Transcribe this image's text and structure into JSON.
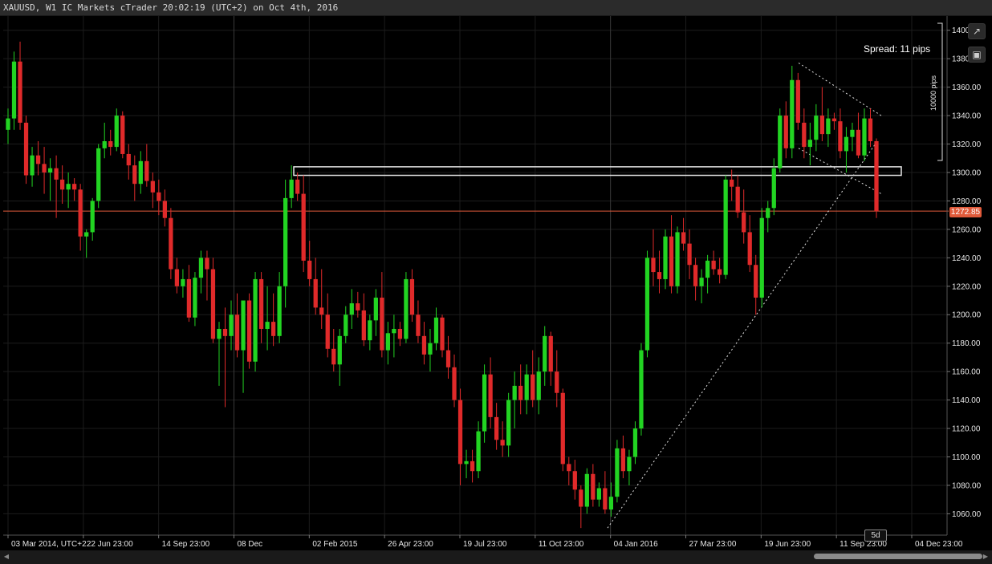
{
  "window": {
    "title": "XAUUSD, W1 IC Markets cTrader 20:02:19 (UTC+2) on Oct 4th, 2016"
  },
  "overlay": {
    "spread_text": "Spread: 11 pips",
    "pips_label": "10000 pips",
    "current_price": "1272.85",
    "timeframe_badge": "5d",
    "popout_icon": "popout-icon",
    "camera_icon": "camera-icon"
  },
  "colors": {
    "background": "#000000",
    "bull": "#22d422",
    "bear": "#e02a2a",
    "price_line": "#e05a3a",
    "grid": "#1c1c1c",
    "axis_text": "#e6e6e6"
  },
  "chart_data": {
    "type": "candlestick",
    "symbol": "XAUUSD",
    "timeframe": "W1",
    "ylim": [
      1045,
      1410
    ],
    "y_ticks": [
      1060,
      1080,
      1100,
      1120,
      1140,
      1160,
      1180,
      1200,
      1220,
      1240,
      1260,
      1280,
      1300,
      1320,
      1340,
      1360,
      1380,
      1400
    ],
    "y_tick_labels": [
      "1060.00",
      "1080.00",
      "1100.00",
      "1120.00",
      "1140.00",
      "1160.00",
      "1180.00",
      "1200.00",
      "1220.00",
      "1240.00",
      "1260.00",
      "1280.00",
      "1300.00",
      "1320.00",
      "1340.00",
      "1360.00",
      "1380.00",
      "1400.00"
    ],
    "x_tick_labels": [
      "03 Mar 2014, UTC+2",
      "22 Jun 23:00",
      "14 Sep 23:00",
      "08 Dec",
      "02 Feb 2015",
      "26 Apr 23:00",
      "19 Jul 23:00",
      "11 Oct 23:00",
      "04 Jan 2016",
      "27 Mar 23:00",
      "19 Jun 23:00",
      "11 Sep 23:00",
      "04 Dec 23:00"
    ],
    "current_price": 1272.85,
    "candles": [
      [
        1330,
        1345,
        1320,
        1338
      ],
      [
        1338,
        1385,
        1330,
        1378
      ],
      [
        1378,
        1392,
        1330,
        1335
      ],
      [
        1335,
        1340,
        1292,
        1298
      ],
      [
        1298,
        1318,
        1290,
        1312
      ],
      [
        1312,
        1322,
        1298,
        1306
      ],
      [
        1306,
        1318,
        1285,
        1300
      ],
      [
        1300,
        1310,
        1280,
        1303
      ],
      [
        1303,
        1312,
        1268,
        1295
      ],
      [
        1295,
        1305,
        1278,
        1288
      ],
      [
        1288,
        1300,
        1275,
        1292
      ],
      [
        1292,
        1296,
        1280,
        1288
      ],
      [
        1288,
        1292,
        1245,
        1255
      ],
      [
        1255,
        1260,
        1240,
        1258
      ],
      [
        1258,
        1282,
        1252,
        1280
      ],
      [
        1280,
        1320,
        1275,
        1317
      ],
      [
        1317,
        1335,
        1310,
        1322
      ],
      [
        1322,
        1330,
        1312,
        1318
      ],
      [
        1318,
        1345,
        1315,
        1340
      ],
      [
        1340,
        1343,
        1310,
        1313
      ],
      [
        1313,
        1320,
        1295,
        1305
      ],
      [
        1305,
        1312,
        1280,
        1292
      ],
      [
        1292,
        1315,
        1285,
        1308
      ],
      [
        1308,
        1320,
        1290,
        1294
      ],
      [
        1294,
        1300,
        1275,
        1286
      ],
      [
        1286,
        1295,
        1270,
        1280
      ],
      [
        1280,
        1288,
        1262,
        1268
      ],
      [
        1268,
        1275,
        1225,
        1232
      ],
      [
        1232,
        1240,
        1215,
        1220
      ],
      [
        1220,
        1232,
        1212,
        1225
      ],
      [
        1225,
        1235,
        1195,
        1198
      ],
      [
        1198,
        1230,
        1192,
        1226
      ],
      [
        1226,
        1245,
        1215,
        1240
      ],
      [
        1240,
        1245,
        1210,
        1232
      ],
      [
        1232,
        1240,
        1180,
        1183
      ],
      [
        1183,
        1195,
        1150,
        1190
      ],
      [
        1190,
        1205,
        1135,
        1185
      ],
      [
        1185,
        1210,
        1175,
        1200
      ],
      [
        1200,
        1215,
        1170,
        1175
      ],
      [
        1175,
        1198,
        1145,
        1210
      ],
      [
        1210,
        1215,
        1162,
        1167
      ],
      [
        1167,
        1230,
        1160,
        1225
      ],
      [
        1225,
        1230,
        1180,
        1190
      ],
      [
        1190,
        1220,
        1175,
        1195
      ],
      [
        1195,
        1215,
        1178,
        1185
      ],
      [
        1185,
        1230,
        1180,
        1220
      ],
      [
        1220,
        1295,
        1205,
        1282
      ],
      [
        1282,
        1305,
        1275,
        1295
      ],
      [
        1295,
        1300,
        1280,
        1285
      ],
      [
        1285,
        1298,
        1230,
        1238
      ],
      [
        1238,
        1252,
        1220,
        1225
      ],
      [
        1225,
        1240,
        1200,
        1205
      ],
      [
        1205,
        1232,
        1190,
        1200
      ],
      [
        1200,
        1215,
        1170,
        1176
      ],
      [
        1176,
        1190,
        1160,
        1165
      ],
      [
        1165,
        1190,
        1150,
        1185
      ],
      [
        1185,
        1206,
        1180,
        1200
      ],
      [
        1200,
        1218,
        1190,
        1208
      ],
      [
        1208,
        1216,
        1198,
        1203
      ],
      [
        1203,
        1215,
        1178,
        1182
      ],
      [
        1182,
        1200,
        1175,
        1196
      ],
      [
        1196,
        1218,
        1185,
        1212
      ],
      [
        1212,
        1230,
        1170,
        1175
      ],
      [
        1175,
        1195,
        1165,
        1187
      ],
      [
        1187,
        1200,
        1170,
        1190
      ],
      [
        1190,
        1195,
        1178,
        1183
      ],
      [
        1183,
        1230,
        1180,
        1225
      ],
      [
        1225,
        1232,
        1195,
        1200
      ],
      [
        1200,
        1210,
        1180,
        1185
      ],
      [
        1185,
        1195,
        1165,
        1172
      ],
      [
        1172,
        1190,
        1160,
        1180
      ],
      [
        1180,
        1205,
        1175,
        1198
      ],
      [
        1198,
        1200,
        1170,
        1175
      ],
      [
        1175,
        1185,
        1155,
        1163
      ],
      [
        1163,
        1172,
        1135,
        1140
      ],
      [
        1140,
        1148,
        1080,
        1095
      ],
      [
        1095,
        1105,
        1085,
        1097
      ],
      [
        1097,
        1105,
        1082,
        1090
      ],
      [
        1090,
        1125,
        1085,
        1118
      ],
      [
        1118,
        1165,
        1110,
        1158
      ],
      [
        1158,
        1170,
        1120,
        1128
      ],
      [
        1128,
        1138,
        1105,
        1112
      ],
      [
        1112,
        1125,
        1100,
        1108
      ],
      [
        1108,
        1145,
        1100,
        1140
      ],
      [
        1140,
        1160,
        1120,
        1150
      ],
      [
        1150,
        1165,
        1130,
        1140
      ],
      [
        1140,
        1165,
        1130,
        1158
      ],
      [
        1158,
        1175,
        1135,
        1140
      ],
      [
        1140,
        1170,
        1130,
        1160
      ],
      [
        1160,
        1192,
        1150,
        1185
      ],
      [
        1185,
        1188,
        1150,
        1160
      ],
      [
        1160,
        1175,
        1135,
        1145
      ],
      [
        1145,
        1148,
        1090,
        1095
      ],
      [
        1095,
        1100,
        1080,
        1090
      ],
      [
        1090,
        1098,
        1070,
        1077
      ],
      [
        1077,
        1080,
        1050,
        1065
      ],
      [
        1065,
        1092,
        1060,
        1088
      ],
      [
        1088,
        1095,
        1065,
        1070
      ],
      [
        1070,
        1082,
        1065,
        1078
      ],
      [
        1078,
        1090,
        1060,
        1063
      ],
      [
        1063,
        1082,
        1058,
        1072
      ],
      [
        1072,
        1112,
        1068,
        1106
      ],
      [
        1106,
        1115,
        1085,
        1090
      ],
      [
        1090,
        1105,
        1080,
        1100
      ],
      [
        1100,
        1125,
        1095,
        1120
      ],
      [
        1120,
        1180,
        1115,
        1175
      ],
      [
        1175,
        1245,
        1170,
        1240
      ],
      [
        1240,
        1260,
        1220,
        1230
      ],
      [
        1230,
        1245,
        1215,
        1225
      ],
      [
        1225,
        1260,
        1218,
        1255
      ],
      [
        1255,
        1270,
        1215,
        1220
      ],
      [
        1220,
        1262,
        1215,
        1258
      ],
      [
        1258,
        1268,
        1245,
        1250
      ],
      [
        1250,
        1260,
        1225,
        1235
      ],
      [
        1235,
        1240,
        1210,
        1220
      ],
      [
        1220,
        1232,
        1208,
        1226
      ],
      [
        1226,
        1242,
        1215,
        1238
      ],
      [
        1238,
        1245,
        1228,
        1232
      ],
      [
        1232,
        1240,
        1222,
        1228
      ],
      [
        1228,
        1298,
        1225,
        1295
      ],
      [
        1295,
        1302,
        1280,
        1290
      ],
      [
        1290,
        1298,
        1268,
        1272
      ],
      [
        1272,
        1288,
        1250,
        1258
      ],
      [
        1258,
        1270,
        1230,
        1235
      ],
      [
        1235,
        1242,
        1200,
        1212
      ],
      [
        1212,
        1275,
        1205,
        1268
      ],
      [
        1268,
        1280,
        1258,
        1275
      ],
      [
        1275,
        1310,
        1270,
        1303
      ],
      [
        1303,
        1345,
        1300,
        1340
      ],
      [
        1340,
        1350,
        1310,
        1317
      ],
      [
        1317,
        1375,
        1310,
        1365
      ],
      [
        1365,
        1370,
        1330,
        1335
      ],
      [
        1335,
        1345,
        1310,
        1318
      ],
      [
        1318,
        1335,
        1305,
        1323
      ],
      [
        1323,
        1348,
        1315,
        1340
      ],
      [
        1340,
        1360,
        1322,
        1327
      ],
      [
        1327,
        1345,
        1318,
        1338
      ],
      [
        1338,
        1342,
        1330,
        1336
      ],
      [
        1336,
        1345,
        1310,
        1315
      ],
      [
        1315,
        1332,
        1300,
        1325
      ],
      [
        1325,
        1335,
        1315,
        1330
      ],
      [
        1330,
        1342,
        1310,
        1312
      ],
      [
        1312,
        1345,
        1308,
        1338
      ],
      [
        1338,
        1345,
        1318,
        1322
      ],
      [
        1322,
        1324,
        1268,
        1272.85
      ]
    ],
    "drawings": {
      "support_band": [
        1298,
        1304
      ],
      "ascending_trendline": [
        [
          0,
          1050
        ],
        [
          1,
          1322
        ]
      ],
      "descending_channel_top": [
        1377,
        1340
      ],
      "descending_channel_bottom": [
        1317,
        1285
      ]
    }
  }
}
